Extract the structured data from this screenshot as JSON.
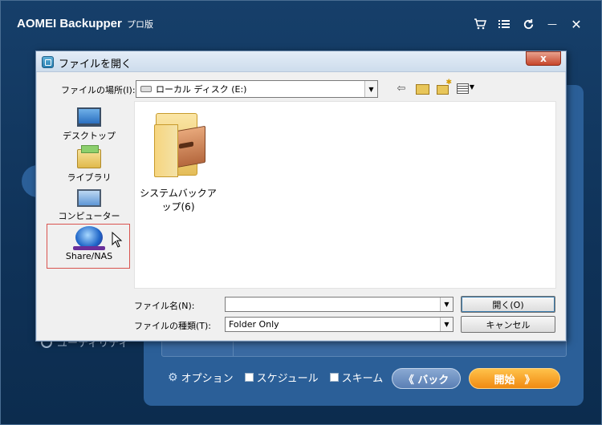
{
  "app": {
    "title": "AOMEI Backupper",
    "edition": "プロ版",
    "controls": {
      "cart": "cart-icon",
      "menu": "menu-icon",
      "refresh": "refresh-icon",
      "minimize": "—",
      "close": "✕"
    },
    "side_item_label": "ユーティリティ",
    "options_label": "オプション",
    "schedule_label": "スケジュール",
    "scheme_label": "スキーム",
    "back_button": "《 バック",
    "start_button": "開始",
    "start_arrow": "》"
  },
  "dialog": {
    "title": "ファイルを開く",
    "close_label": "x",
    "look_in_label": "ファイルの場所(I):",
    "look_in_value": "ローカル ディスク (E:)",
    "places": [
      {
        "label": "デスクトップ",
        "icon": "desktop-icon"
      },
      {
        "label": "ライブラリ",
        "icon": "library-icon"
      },
      {
        "label": "コンピューター",
        "icon": "computer-icon"
      },
      {
        "label": "Share/NAS",
        "icon": "network-icon"
      }
    ],
    "files": [
      {
        "name": "システムバックアップ(6)",
        "icon": "folder-icon"
      }
    ],
    "file_name_label": "ファイル名(N):",
    "file_name_value": "",
    "file_type_label": "ファイルの種類(T):",
    "file_type_value": "Folder Only",
    "open_button": "開く(O)",
    "cancel_button": "キャンセル"
  },
  "colors": {
    "app_background": "#0f3258",
    "panel": "#2b5f98",
    "start_button": "#f08a12",
    "back_button": "#5a7fb4",
    "highlight_border": "#d9534f"
  }
}
